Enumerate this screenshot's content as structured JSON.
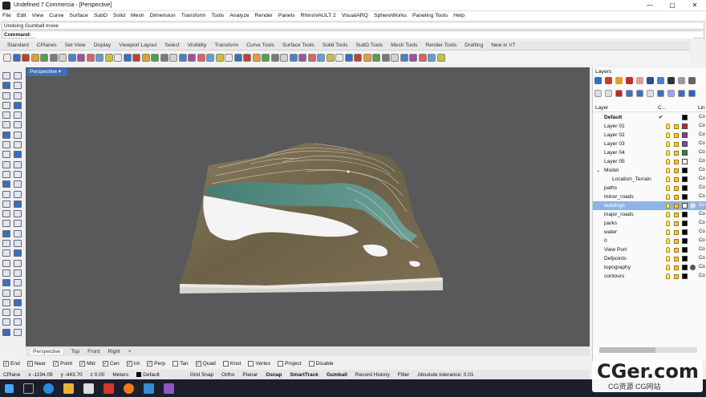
{
  "window": {
    "title": "Undefined 7 Commercia - [Perspective]",
    "minimize": "—",
    "maximize": "▢",
    "close": "✕"
  },
  "menu": [
    "File",
    "Edit",
    "View",
    "Curve",
    "Surface",
    "SubD",
    "Solid",
    "Mesh",
    "Dimension",
    "Transform",
    "Tools",
    "Analyze",
    "Render",
    "Panels",
    "RhinoVAULT 2",
    "VisualARQ",
    "SphereWorks",
    "Paneling Tools",
    "Help"
  ],
  "command": {
    "history": "Undoing Gumball move",
    "label": "Command:",
    "value": ""
  },
  "toolbar_tabs": [
    "Standard",
    "CPlanes",
    "Set View",
    "Display",
    "Viewport Layout",
    "Select",
    "Visibility",
    "Transform",
    "Curve Tools",
    "Surface Tools",
    "Solid Tools",
    "SubD Tools",
    "Mesh Tools",
    "Render Tools",
    "Drafting",
    "New in V7"
  ],
  "viewport": {
    "label": "Perspective ▾"
  },
  "viewport_tabs": [
    "Perspective",
    "Top",
    "Front",
    "Right",
    "+"
  ],
  "osnaps": [
    {
      "label": "End",
      "checked": true
    },
    {
      "label": "Near",
      "checked": true
    },
    {
      "label": "Point",
      "checked": true
    },
    {
      "label": "Mid",
      "checked": true
    },
    {
      "label": "Cen",
      "checked": true
    },
    {
      "label": "Int",
      "checked": true
    },
    {
      "label": "Perp",
      "checked": true
    },
    {
      "label": "Tan",
      "checked": false
    },
    {
      "label": "Quad",
      "checked": true
    },
    {
      "label": "Knot",
      "checked": false
    },
    {
      "label": "Vertex",
      "checked": false
    },
    {
      "label": "Project",
      "checked": false
    },
    {
      "label": "Disable",
      "checked": false
    }
  ],
  "status": {
    "cplane": "CPlane",
    "x": "x -1194.09",
    "y": "y -443.70",
    "z": "z 0.00",
    "units": "Meters",
    "layer": "Default",
    "grid_snap": "Grid Snap",
    "ortho": "Ortho",
    "planar": "Planar",
    "osnap": "Osnap",
    "smarttrack": "SmartTrack",
    "gumball": "Gumball",
    "record": "Record History",
    "filter": "Filter",
    "tolerance": "Absolute tolerance: 0.01"
  },
  "layers": {
    "title": "Layers",
    "header": {
      "layer": "Layer",
      "current": "C...",
      "linetype": "Lin"
    },
    "rows": [
      {
        "name": "Default",
        "indent": 0,
        "bold": true,
        "current": "✔",
        "color": "#000000",
        "material": "",
        "lt": "Co"
      },
      {
        "name": "Layer 01",
        "indent": 0,
        "color": "#c0282a",
        "lt": "Co"
      },
      {
        "name": "Layer 02",
        "indent": 0,
        "color": "#8a3aa8",
        "lt": "Co"
      },
      {
        "name": "Layer 03",
        "indent": 0,
        "color": "#6a4ac0",
        "lt": "Co"
      },
      {
        "name": "Layer 04",
        "indent": 0,
        "color": "#2a8a2a",
        "lt": "Co"
      },
      {
        "name": "Layer 05",
        "indent": 0,
        "color": "#ffffff",
        "lt": "Co"
      },
      {
        "name": "Model",
        "indent": 0,
        "expander": "⌄",
        "color": "#000000",
        "lt": "Co"
      },
      {
        "name": "Location_Terrain",
        "indent": 1,
        "color": "#000000",
        "lt": "Co"
      },
      {
        "name": "paths",
        "indent": 0,
        "color": "#000000",
        "lt": "Co"
      },
      {
        "name": "minor_roads",
        "indent": 0,
        "color": "#000000",
        "lt": "Co"
      },
      {
        "name": "buildings",
        "indent": 0,
        "selected": true,
        "color": "#ffffff",
        "material": "#e0e0e0",
        "lt": "Co"
      },
      {
        "name": "major_roads",
        "indent": 0,
        "color": "#000000",
        "lt": "Co"
      },
      {
        "name": "parks",
        "indent": 0,
        "color": "#000000",
        "lt": "Co"
      },
      {
        "name": "water",
        "indent": 0,
        "color": "#000000",
        "lt": "Co"
      },
      {
        "name": "0",
        "indent": 0,
        "color": "#000000",
        "lt": "Co"
      },
      {
        "name": "View Port",
        "indent": 0,
        "color": "#000000",
        "lt": "Co"
      },
      {
        "name": "Defpoints",
        "indent": 0,
        "color": "#000000",
        "lt": "Co"
      },
      {
        "name": "topography",
        "indent": 0,
        "color": "#000000",
        "material": "#555555",
        "lt": "Co"
      },
      {
        "name": "contours",
        "indent": 0,
        "color": "#000000",
        "lt": "Co"
      }
    ]
  },
  "watermark": {
    "big": "CGer.com",
    "small": "CG资源 CG网站"
  },
  "colors": {
    "viewport_bg": "#58595b",
    "selection": "#8fb4e3",
    "accent": "#3d6fb5"
  }
}
